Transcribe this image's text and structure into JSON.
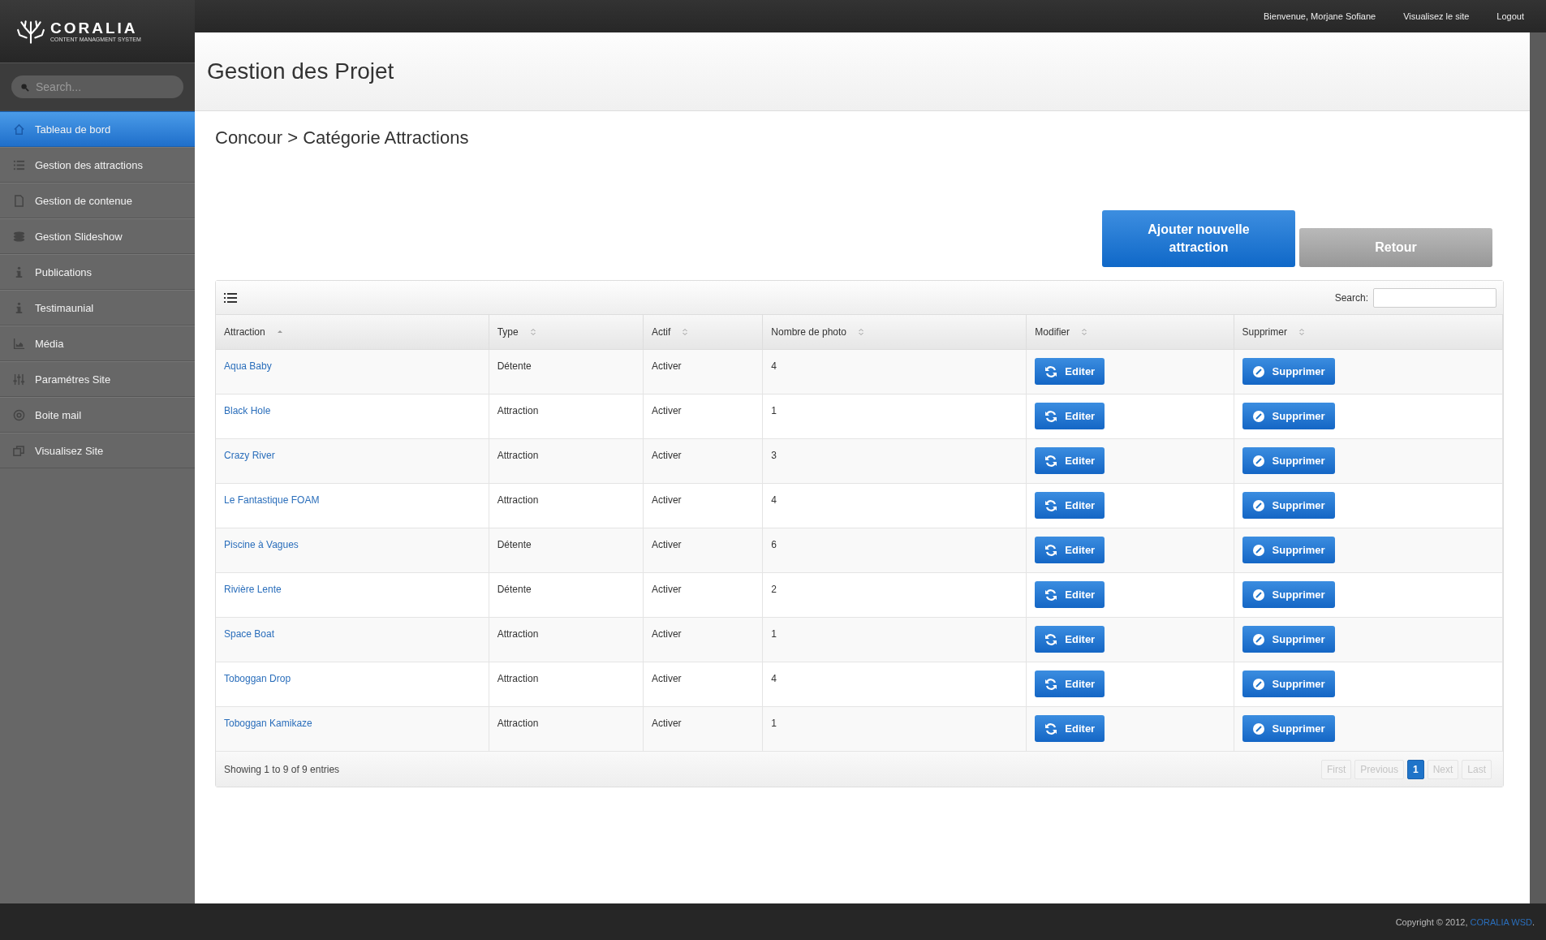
{
  "brand": {
    "name": "CORALIA",
    "tagline": "CONTENT MANAGMENT SYSTEM"
  },
  "top_links": [
    "Bienvenue, Morjane Sofiane",
    "Visualisez le site",
    "Logout"
  ],
  "sidebar": {
    "search_placeholder": "Search...",
    "items": [
      {
        "label": "Tableau de bord",
        "selected": true
      },
      {
        "label": "Gestion des attractions",
        "selected": false
      },
      {
        "label": "Gestion de contenue",
        "selected": false
      },
      {
        "label": "Gestion Slideshow",
        "selected": false
      },
      {
        "label": "Publications",
        "selected": false
      },
      {
        "label": "Testimaunial",
        "selected": false
      },
      {
        "label": "Média",
        "selected": false
      },
      {
        "label": "Paramétres Site",
        "selected": false
      },
      {
        "label": "Boite mail",
        "selected": false
      },
      {
        "label": "Visualisez Site",
        "selected": false
      }
    ]
  },
  "page_title": "Gestion des Projet",
  "breadcrumb": "Concour > Catégorie Attractions",
  "actions": [
    {
      "label": "Ajouter nouvelle attraction",
      "kind": "primary"
    },
    {
      "label": "Retour",
      "kind": "secondary"
    }
  ],
  "table": {
    "search_label": "Search:",
    "columns": [
      {
        "label": "Attraction",
        "sorted": true
      },
      {
        "label": "Type",
        "sorted": false
      },
      {
        "label": "Actif",
        "sorted": false
      },
      {
        "label": "Nombre de photo",
        "sorted": false
      },
      {
        "label": "Modifier",
        "sorted": false
      },
      {
        "label": "Supprimer",
        "sorted": false
      }
    ],
    "rows": [
      {
        "attraction": "Aqua Baby",
        "type": "Détente",
        "actif": "Activer",
        "photos": "4",
        "edit": "Editer",
        "delete": "Supprimer"
      },
      {
        "attraction": "Black Hole",
        "type": "Attraction",
        "actif": "Activer",
        "photos": "1",
        "edit": "Editer",
        "delete": "Supprimer"
      },
      {
        "attraction": "Crazy River",
        "type": "Attraction",
        "actif": "Activer",
        "photos": "3",
        "edit": "Editer",
        "delete": "Supprimer"
      },
      {
        "attraction": "Le Fantastique FOAM",
        "type": "Attraction",
        "actif": "Activer",
        "photos": "4",
        "edit": "Editer",
        "delete": "Supprimer"
      },
      {
        "attraction": "Piscine à Vagues",
        "type": "Détente",
        "actif": "Activer",
        "photos": "6",
        "edit": "Editer",
        "delete": "Supprimer"
      },
      {
        "attraction": "Rivière Lente",
        "type": "Détente",
        "actif": "Activer",
        "photos": "2",
        "edit": "Editer",
        "delete": "Supprimer"
      },
      {
        "attraction": "Space Boat",
        "type": "Attraction",
        "actif": "Activer",
        "photos": "1",
        "edit": "Editer",
        "delete": "Supprimer"
      },
      {
        "attraction": "Toboggan Drop",
        "type": "Attraction",
        "actif": "Activer",
        "photos": "4",
        "edit": "Editer",
        "delete": "Supprimer"
      },
      {
        "attraction": "Toboggan Kamikaze",
        "type": "Attraction",
        "actif": "Activer",
        "photos": "1",
        "edit": "Editer",
        "delete": "Supprimer"
      }
    ],
    "info": "Showing 1 to 9 of 9 entries",
    "pagination": [
      {
        "label": "First",
        "selected": false,
        "disabled": true
      },
      {
        "label": "Previous",
        "selected": false,
        "disabled": true
      },
      {
        "label": "1",
        "selected": true,
        "disabled": false
      },
      {
        "label": "Next",
        "selected": false,
        "disabled": true
      },
      {
        "label": "Last",
        "selected": false,
        "disabled": true
      }
    ]
  },
  "footer": {
    "text": "Copyright © 2012,",
    "link": "CORALIA WSD",
    "end": "."
  }
}
